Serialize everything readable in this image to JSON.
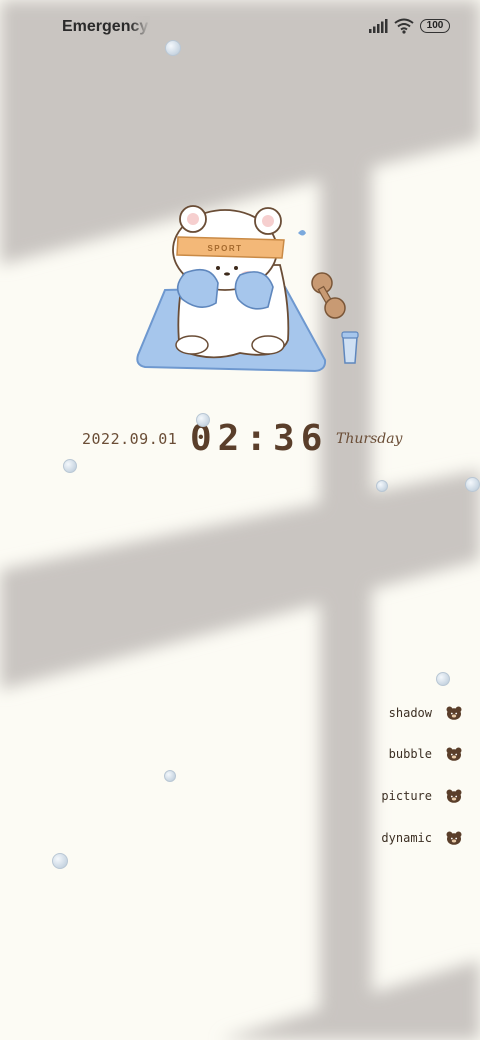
{
  "status_bar": {
    "carrier_text": "Emergency c",
    "battery_level": "100",
    "icons": [
      "signal-icon",
      "wifi-icon",
      "battery-icon"
    ]
  },
  "lockscreen": {
    "date": "2022.09.01",
    "time": "02:36",
    "weekday": "Thursday",
    "illustration_text": "SPORT"
  },
  "menu": {
    "items": [
      {
        "label": "shadow",
        "icon": "bear-icon"
      },
      {
        "label": "bubble",
        "icon": "bear-icon"
      },
      {
        "label": "picture",
        "icon": "bear-icon"
      },
      {
        "label": "dynamic",
        "icon": "bear-icon"
      }
    ]
  },
  "colors": {
    "background": "#fcfbf4",
    "shadow": "#c8c4c0",
    "text_brown": "#5a3e2a",
    "mat_blue": "#9fc1e8",
    "headband_orange": "#f0b97a"
  }
}
